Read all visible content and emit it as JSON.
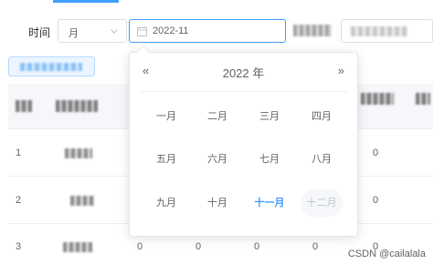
{
  "filter": {
    "time_label": "时间",
    "period_value": "月",
    "date_value": "2022-11"
  },
  "picker": {
    "year": "2022 年",
    "prev_glyph": "«",
    "next_glyph": "»",
    "months": [
      "一月",
      "二月",
      "三月",
      "四月",
      "五月",
      "六月",
      "七月",
      "八月",
      "九月",
      "十月",
      "十一月",
      "十二月"
    ],
    "current_month": "十一月",
    "disabled_month": "十二月"
  },
  "table": {
    "rows": [
      {
        "index": "1",
        "zero1": "0"
      },
      {
        "index": "2",
        "zero1": "0"
      },
      {
        "index": "3",
        "zero1": "0",
        "zero2": "0",
        "zero3": "0",
        "zero4": "0",
        "zero5": "0"
      }
    ]
  },
  "watermark": "CSDN @cailalala",
  "colors": {
    "accent": "#409eff",
    "disabled_bg": "#f5f7fa",
    "header_bg": "#f5f7fa"
  }
}
